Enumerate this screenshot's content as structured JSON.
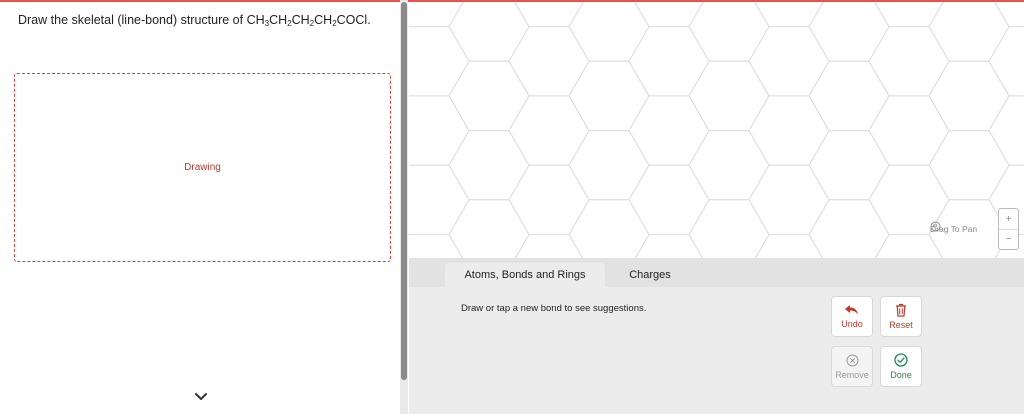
{
  "question": {
    "prefix": "Draw the skeletal (line-bond) structure of ",
    "formula": [
      {
        "t": "CH"
      },
      {
        "s": "3"
      },
      {
        "t": "CH"
      },
      {
        "s": "2"
      },
      {
        "t": "CH"
      },
      {
        "s": "2"
      },
      {
        "t": "CH"
      },
      {
        "s": "2"
      },
      {
        "t": "COCl."
      }
    ]
  },
  "drawing": {
    "label": "Drawing"
  },
  "canvas": {
    "pan_label": "Drag To Pan",
    "zoom_in": "+",
    "zoom_out": "−"
  },
  "tabs": [
    {
      "label": "Atoms, Bonds and Rings"
    },
    {
      "label": "Charges"
    }
  ],
  "hint": "Draw or tap a new bond to see suggestions.",
  "buttons": {
    "undo": "Undo",
    "reset": "Reset",
    "remove": "Remove",
    "done": "Done"
  },
  "colors": {
    "accent": "#c0392b",
    "done": "#1f8a55",
    "grid": "#dedede"
  }
}
